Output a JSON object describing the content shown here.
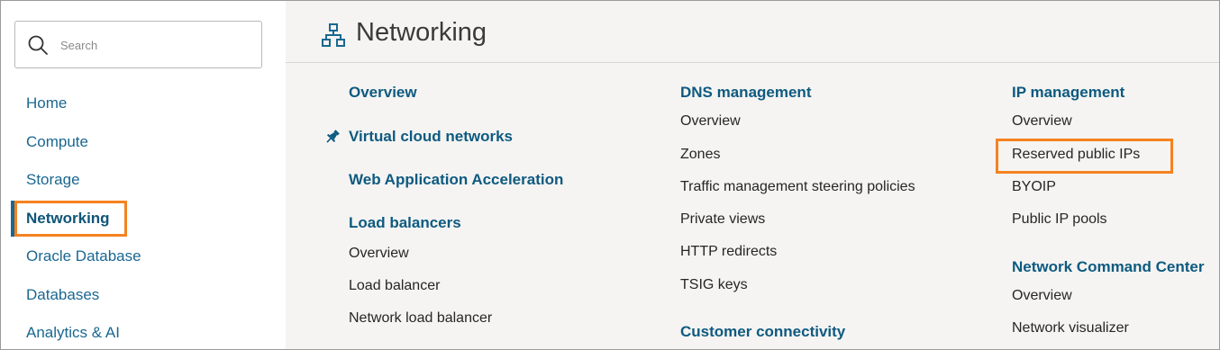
{
  "search": {
    "placeholder": "Search"
  },
  "sidebar": {
    "items": [
      {
        "label": "Home"
      },
      {
        "label": "Compute"
      },
      {
        "label": "Storage"
      },
      {
        "label": "Networking"
      },
      {
        "label": "Oracle Database"
      },
      {
        "label": "Databases"
      },
      {
        "label": "Analytics & AI"
      }
    ],
    "active": "Networking"
  },
  "header": {
    "title": "Networking",
    "icon": "network-icon"
  },
  "columns": {
    "col1": {
      "overview": "Overview",
      "vcn": "Virtual cloud networks",
      "vcn_icon": "pin-icon",
      "waa": "Web Application Acceleration",
      "lb": {
        "heading": "Load balancers",
        "items": [
          "Overview",
          "Load balancer",
          "Network load balancer"
        ]
      }
    },
    "col2": {
      "dns": {
        "heading": "DNS management",
        "items": [
          "Overview",
          "Zones",
          "Traffic management steering policies",
          "Private views",
          "HTTP redirects",
          "TSIG keys"
        ]
      },
      "cc": {
        "heading": "Customer connectivity"
      }
    },
    "col3": {
      "ip": {
        "heading": "IP management",
        "items": [
          "Overview",
          "Reserved public IPs",
          "BYOIP",
          "Public IP pools"
        ]
      },
      "ncc": {
        "heading": "Network Command Center",
        "items": [
          "Overview",
          "Network visualizer"
        ]
      }
    }
  },
  "colors": {
    "highlight": "#f58220",
    "link": "#0e5a80",
    "nav": "#1a6791"
  }
}
